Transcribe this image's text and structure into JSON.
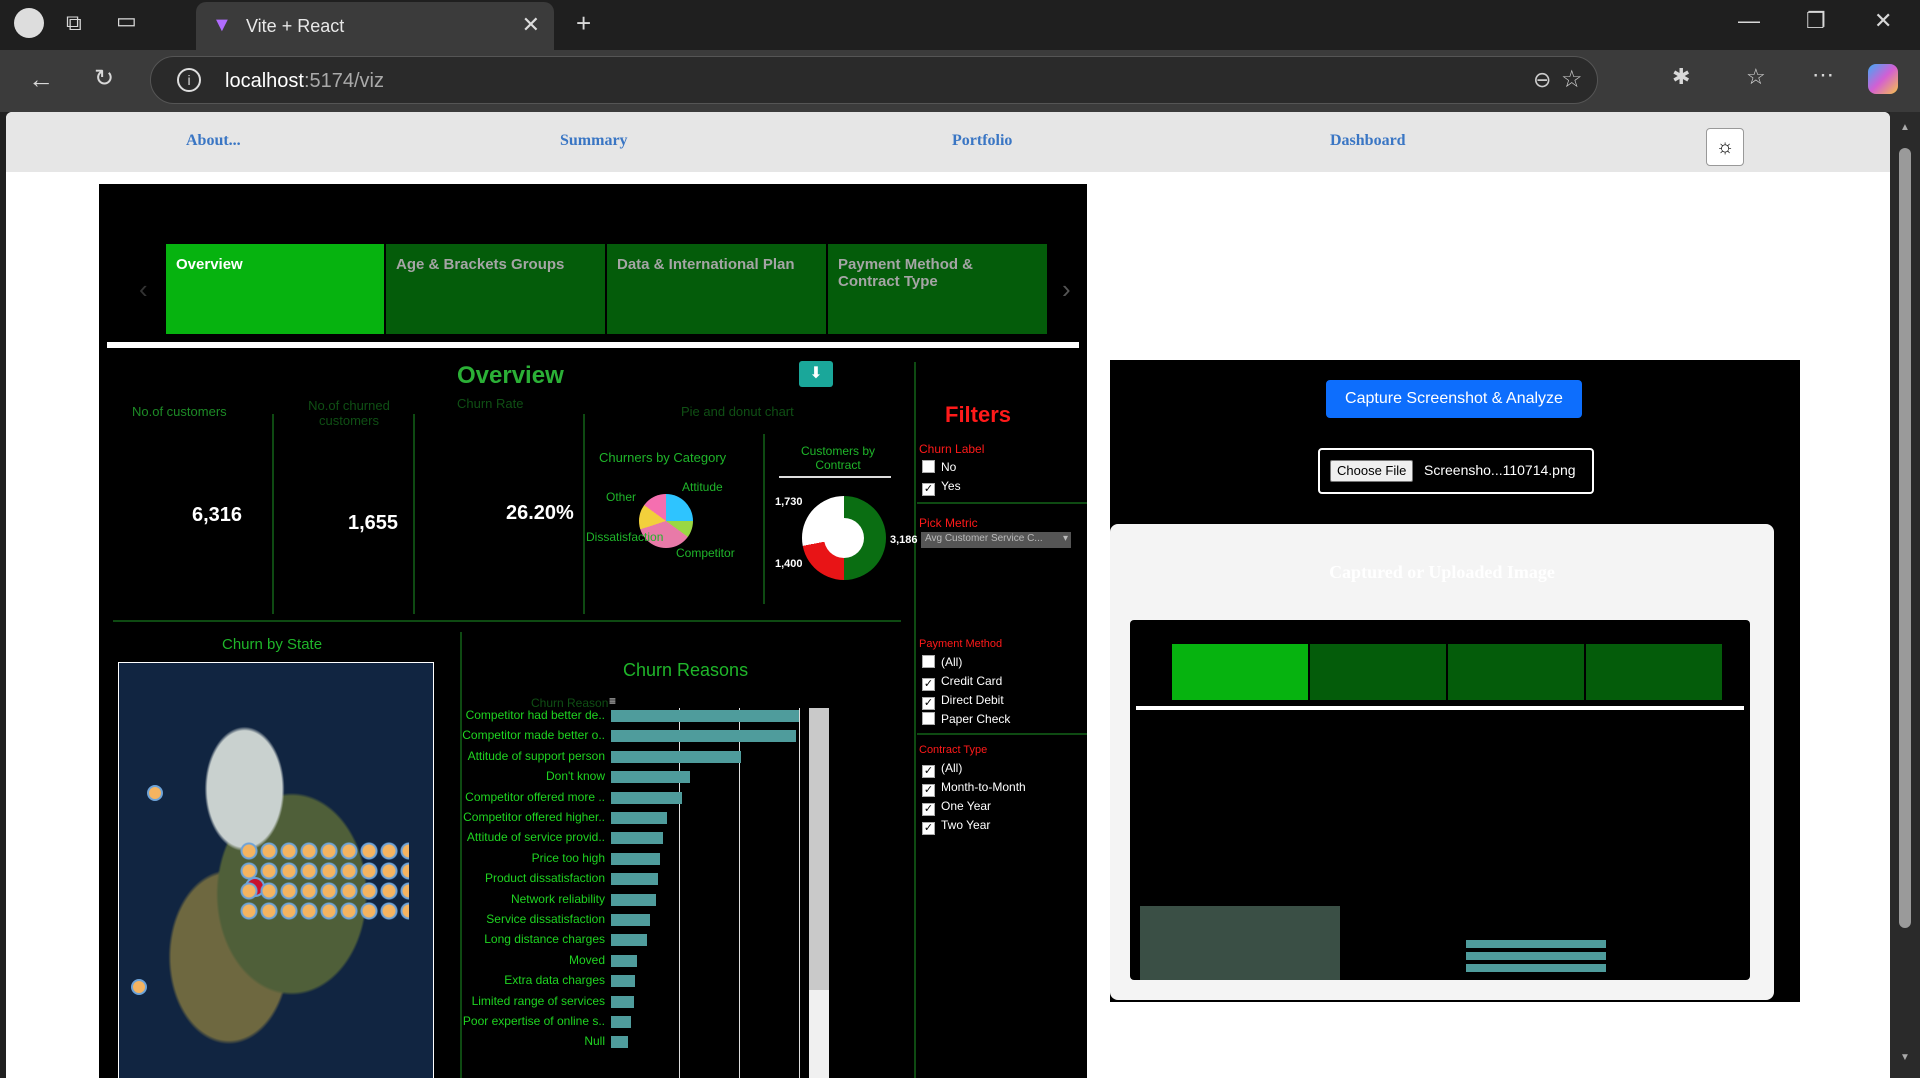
{
  "browser": {
    "tab_title": "Vite + React",
    "url_host": "localhost",
    "url_path": ":5174/viz"
  },
  "nav": {
    "links": [
      "About...",
      "Summary",
      "Portfolio",
      "Dashboard"
    ]
  },
  "dashboard": {
    "tabs": [
      "Overview",
      "Age & Brackets Groups",
      "Data & International Plan",
      "Payment Method & Contract Type"
    ],
    "title": "Overview",
    "kpi_labels": {
      "customers": "No.of customers",
      "churned": "No.of churned customers",
      "churn_rate": "Churn Rate",
      "pie": "Pie and donut chart"
    },
    "kpi_values": {
      "customers": "6,316",
      "churned": "1,655",
      "churn_rate": "26.20%"
    },
    "pie_title": "Churners by Category",
    "pie_labels": [
      "Other",
      "Attitude",
      "Dissatisfaction",
      "Competitor"
    ],
    "donut_title": "Customers by Contract",
    "donut_labels": [
      "1,730",
      "3,186",
      "1,400"
    ],
    "map_title": "Churn by State",
    "reasons_title": "Churn Reasons",
    "reasons_header": "Churn Reason",
    "filters": {
      "title": "Filters",
      "churn_label": "Churn Label",
      "churn_options": [
        {
          "label": "No",
          "checked": false
        },
        {
          "label": "Yes",
          "checked": true
        }
      ],
      "pick_metric": "Pick Metric",
      "metric_value": "Avg Customer Service C...",
      "payment_method": "Payment Method",
      "payment_options": [
        {
          "label": "(All)",
          "checked": false
        },
        {
          "label": "Credit Card",
          "checked": true
        },
        {
          "label": "Direct Debit",
          "checked": true
        },
        {
          "label": "Paper Check",
          "checked": false
        }
      ],
      "contract_type": "Contract Type",
      "contract_options": [
        {
          "label": "(All)",
          "checked": true
        },
        {
          "label": "Month-to-Month",
          "checked": true
        },
        {
          "label": "One Year",
          "checked": true
        },
        {
          "label": "Two Year",
          "checked": true
        }
      ]
    }
  },
  "chart_data": {
    "type": "bar",
    "title": "Churn Reasons",
    "categories": [
      "Competitor had better de..",
      "Competitor made better o..",
      "Attitude of support person",
      "Don't know",
      "Competitor offered more ..",
      "Competitor offered higher..",
      "Attitude of service provid..",
      "Price too high",
      "Product dissatisfaction",
      "Network reliability",
      "Service dissatisfaction",
      "Long distance charges",
      "Moved",
      "Extra data charges",
      "Limited range of services",
      "Poor expertise of online s..",
      "Null"
    ],
    "values": [
      192,
      189,
      133,
      81,
      72,
      57,
      53,
      50,
      48,
      46,
      40,
      37,
      27,
      25,
      23,
      20,
      17
    ]
  },
  "analyzer": {
    "capture_label": "Capture Screenshot & Analyze",
    "choose_file": "Choose File",
    "file_name": "Screensho...110714.png",
    "preview_title": "Captured or Uploaded Image"
  },
  "colors": {
    "accent_green": "#06b30f",
    "filter_red": "#ff1a1a",
    "button_blue": "#0d6efd",
    "bar_teal": "#4f9c9c"
  }
}
